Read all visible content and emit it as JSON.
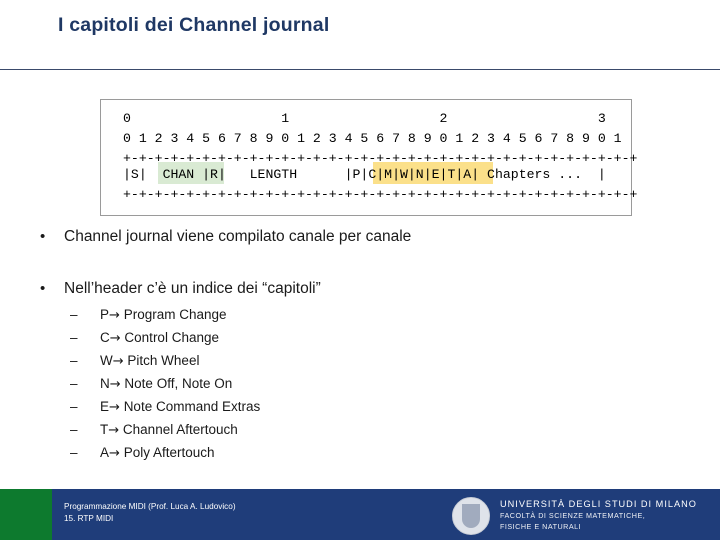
{
  "slide": {
    "title": "I capitoli dei Channel journal"
  },
  "diagram": {
    "line_byte_numbers": "0                   1                   2                   3",
    "line_bit_numbers": "0 1 2 3 4 5 6 7 8 9 0 1 2 3 4 5 6 7 8 9 0 1 2 3 4 5 6 7 8 9 0 1",
    "line_rule_top": "+-+-+-+-+-+-+-+-+-+-+-+-+-+-+-+-+-+-+-+-+-+-+-+-+-+-+-+-+-+-+-+-+",
    "line_fields": "|S|  CHAN |R|   LENGTH      |P|C|M|W|N|E|T|A| Chapters ...  |",
    "line_rule_bottom": "+-+-+-+-+-+-+-+-+-+-+-+-+-+-+-+-+-+-+-+-+-+-+-+-+-+-+-+-+-+-+-+-+",
    "highlight_chan_color": "#d9ead3",
    "highlight_chapters_color": "#fbe08a"
  },
  "bullets": [
    {
      "marker": "•",
      "text": "Channel journal viene compilato canale per canale"
    },
    {
      "marker": "•",
      "text": "Nell’header c’è un indice dei “capitoli”"
    }
  ],
  "subitems": [
    {
      "marker": "–",
      "letter": "P",
      "arrow": "→",
      "text": "Program Change"
    },
    {
      "marker": "–",
      "letter": "C",
      "arrow": "→",
      "text": "Control Change"
    },
    {
      "marker": "–",
      "letter": "W",
      "arrow": "→",
      "text": "Pitch Wheel"
    },
    {
      "marker": "–",
      "letter": "N",
      "arrow": "→",
      "text": "Note Off, Note On"
    },
    {
      "marker": "–",
      "letter": "E",
      "arrow": "→",
      "text": "Note Command Extras"
    },
    {
      "marker": "–",
      "letter": "T",
      "arrow": "→",
      "text": "Channel Aftertouch"
    },
    {
      "marker": "–",
      "letter": "A",
      "arrow": "→",
      "text": "Poly Aftertouch"
    }
  ],
  "footer": {
    "line1": "Programmazione MIDI (Prof. Luca A. Ludovico)",
    "line2": "15. RTP MIDI",
    "university_line1": "UNIVERSITÀ DEGLI STUDI DI MILANO",
    "university_line2": "FACOLTÀ DI SCIENZE MATEMATICHE,",
    "university_line3": "FISICHE E NATURALI",
    "bar_color": "#1f3d7a",
    "accent_color": "#0d7a2e"
  }
}
